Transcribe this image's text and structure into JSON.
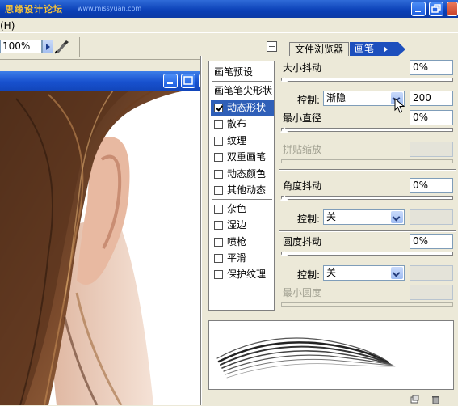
{
  "app": {
    "watermark_text": "思缘设计论坛",
    "watermark_url": "www.missyuan.com",
    "menu_help": "帮助(H)"
  },
  "options": {
    "zoom": "100%"
  },
  "palette_well": {
    "tabs": [
      {
        "label": "文件浏览器",
        "active": false
      },
      {
        "label": "画笔",
        "active": true
      }
    ]
  },
  "brushes_panel": {
    "preset_list": [
      {
        "label": "画笔预设",
        "checkbox": false,
        "checked": false,
        "selected": false
      },
      {
        "label": "画笔笔尖形状",
        "checkbox": false,
        "checked": false,
        "selected": false
      },
      {
        "label": "动态形状",
        "checkbox": true,
        "checked": true,
        "selected": true
      },
      {
        "label": "散布",
        "checkbox": true,
        "checked": false,
        "selected": false
      },
      {
        "label": "纹理",
        "checkbox": true,
        "checked": false,
        "selected": false
      },
      {
        "label": "双重画笔",
        "checkbox": true,
        "checked": false,
        "selected": false
      },
      {
        "label": "动态颜色",
        "checkbox": true,
        "checked": false,
        "selected": false
      },
      {
        "label": "其他动态",
        "checkbox": true,
        "checked": false,
        "selected": false
      },
      {
        "label": "杂色",
        "checkbox": true,
        "checked": false,
        "selected": false
      },
      {
        "label": "湿边",
        "checkbox": true,
        "checked": false,
        "selected": false
      },
      {
        "label": "喷枪",
        "checkbox": true,
        "checked": false,
        "selected": false
      },
      {
        "label": "平滑",
        "checkbox": true,
        "checked": false,
        "selected": false
      },
      {
        "label": "保护纹理",
        "checkbox": true,
        "checked": false,
        "selected": false
      }
    ],
    "size_jitter": {
      "label": "大小抖动",
      "value": "0%",
      "level": 0
    },
    "size_control": {
      "label": "控制:",
      "value": "渐隐",
      "steps": "200"
    },
    "min_diameter": {
      "label": "最小直径",
      "value": "0%",
      "level": 0
    },
    "tilt_scale": {
      "label": "拼贴缩放",
      "value": "",
      "disabled": true
    },
    "angle_jitter": {
      "label": "角度抖动",
      "value": "0%",
      "level": 0
    },
    "angle_control": {
      "label": "控制:",
      "value": "关"
    },
    "roundness_jitter": {
      "label": "圆度抖动",
      "value": "0%",
      "level": 0
    },
    "roundness_control": {
      "label": "控制:",
      "value": "关"
    },
    "min_roundness": {
      "label": "最小圆度",
      "value": "",
      "disabled": true
    }
  },
  "colors": {
    "title_blue": "#0a3fb6",
    "selection_blue": "#2f5fb8",
    "panel_bg": "#ece9d8"
  }
}
